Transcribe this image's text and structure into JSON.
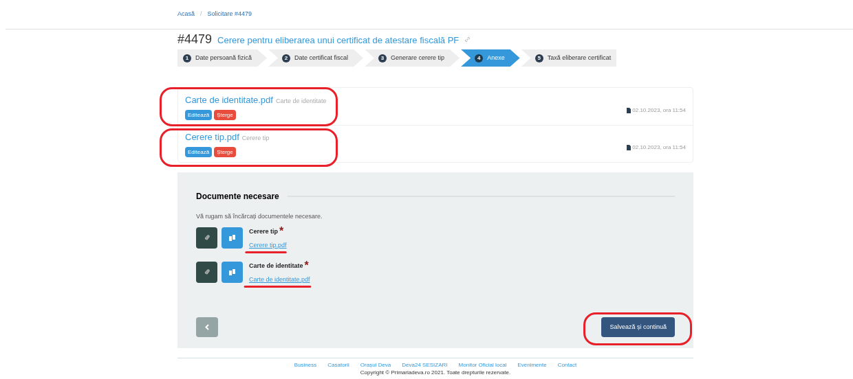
{
  "breadcrumb": [
    {
      "label": "Acasă"
    },
    {
      "label": "Solicitare #4479"
    }
  ],
  "breadcrumb_separator": "/",
  "header": {
    "number": "#4479",
    "title": "Cerere pentru eliberarea unui certificat de atestare fiscală PF"
  },
  "steps": [
    {
      "number": "1",
      "label": "Date persoană fizică",
      "selected": false
    },
    {
      "number": "2",
      "label": "Date certificat fiscal",
      "selected": false
    },
    {
      "number": "3",
      "label": "Generare cerere tip",
      "selected": false
    },
    {
      "number": "4",
      "label": "Anexe",
      "selected": true
    },
    {
      "number": "5",
      "label": "Taxă eliberare certificat",
      "selected": false
    }
  ],
  "files": [
    {
      "name": "Carte de identitate.pdf",
      "description": "Carte de identitate",
      "edit": "Editează",
      "delete": "Șterge",
      "date": "02.10.2023, ora 11:54"
    },
    {
      "name": "Cerere tip.pdf",
      "description": "Cerere tip",
      "edit": "Editează",
      "delete": "Șterge",
      "date": "02.10.2023, ora 11:54"
    }
  ],
  "documents": {
    "title": "Documente necesare",
    "intro": "Vă rugam să încărcați documentele necesare.",
    "required_mark": "*",
    "items": [
      {
        "label": "Cerere tip",
        "file": "Cerere tip.pdf"
      },
      {
        "label": "Carte de identitate",
        "file": "Carte de identitate.pdf"
      }
    ]
  },
  "save_button": "Salvează și continuă",
  "footer": {
    "links": [
      "Business",
      "Casatorii",
      "Orașul Deva",
      "Deva24 SESIZARI",
      "Monitor Oficial local",
      "Evenimente",
      "Contact"
    ],
    "copyright": "Copyright © Primariadeva.ro 2021. Toate drepturile rezervate."
  }
}
